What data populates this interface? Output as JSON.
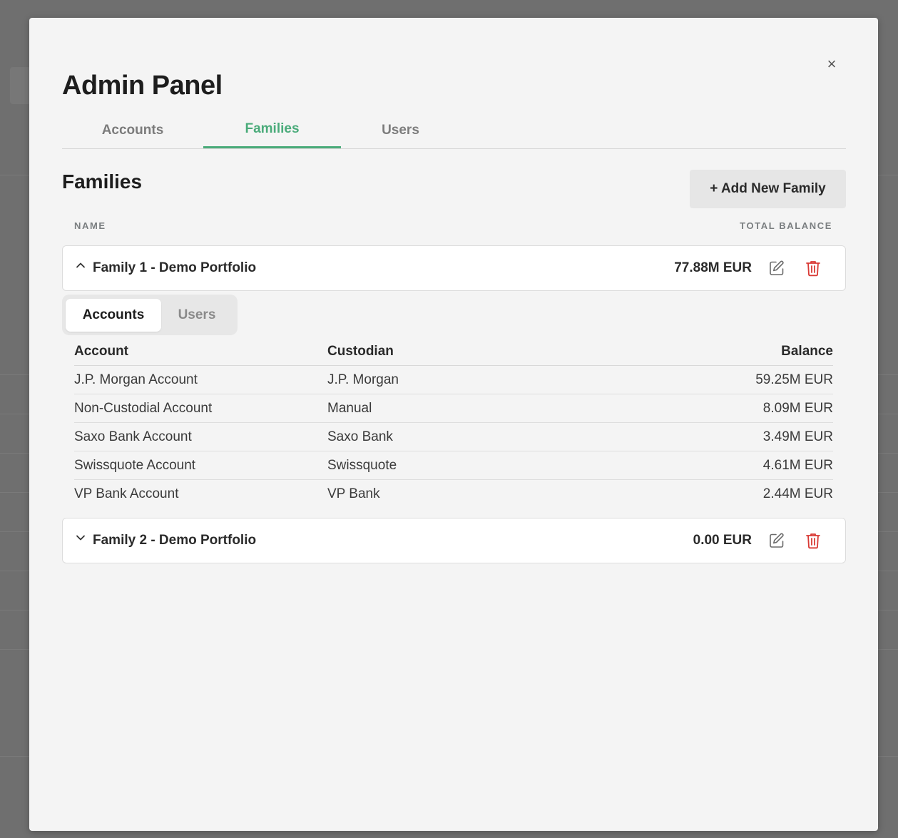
{
  "modal": {
    "title": "Admin Panel",
    "close_label": "×"
  },
  "tabs": [
    {
      "label": "Accounts",
      "active": false
    },
    {
      "label": "Families",
      "active": true
    },
    {
      "label": "Users",
      "active": false
    }
  ],
  "families_section": {
    "title": "Families",
    "add_button_label": "+ Add New Family",
    "col_name": "NAME",
    "col_total_balance": "TOTAL BALANCE"
  },
  "families": [
    {
      "name": "Family 1 - Demo Portfolio",
      "balance": "77.88M EUR",
      "expanded": true,
      "chevron": "chevron-up-icon"
    },
    {
      "name": "Family 2 - Demo Portfolio",
      "balance": "0.00 EUR",
      "expanded": false,
      "chevron": "chevron-down-icon"
    }
  ],
  "subtabs": [
    {
      "label": "Accounts",
      "active": true
    },
    {
      "label": "Users",
      "active": false
    }
  ],
  "account_table": {
    "headers": [
      "Account",
      "Custodian",
      "Balance"
    ],
    "rows": [
      [
        "J.P. Morgan Account",
        "J.P. Morgan",
        "59.25M EUR"
      ],
      [
        "Non-Custodial Account",
        "Manual",
        "8.09M EUR"
      ],
      [
        "Saxo Bank Account",
        "Saxo Bank",
        "3.49M EUR"
      ],
      [
        "Swissquote Account",
        "Swissquote",
        "4.61M EUR"
      ],
      [
        "VP Bank Account",
        "VP Bank",
        "2.44M EUR"
      ]
    ]
  },
  "colors": {
    "accent": "#4aab7a",
    "delete": "#d93a35",
    "edit": "#6b6b6b"
  }
}
